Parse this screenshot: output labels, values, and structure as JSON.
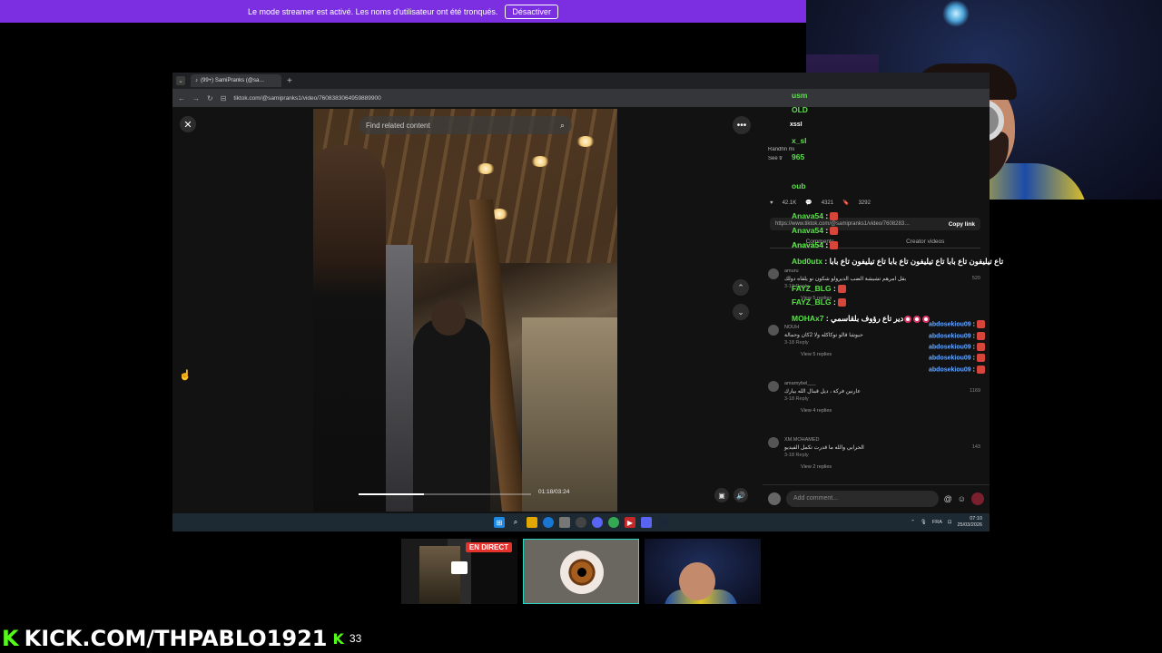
{
  "banner": {
    "text": "Le mode streamer est activé. Les noms d'utilisateur ont été tronqués.",
    "button": "Désactiver"
  },
  "browser": {
    "tab_title": "(99+) SamiPranks (@sa…",
    "url": "tiktok.com/@samipranks1/video/7608383064959889900"
  },
  "viewer": {
    "search_placeholder": "Find related content",
    "time": "01:18/03:24",
    "progress": 0.38
  },
  "panel": {
    "line1": "xssl",
    "line2": "Randhn mi",
    "line3": "See tr",
    "stats": [
      "42.1K",
      "4321",
      "3292"
    ],
    "link_url": "https://www.tiktok.com/@samipranks1/video/7608283…",
    "copy_link": "Copy link",
    "tabs": [
      "Comments",
      "Creator videos"
    ],
    "comments": [
      {
        "user": "amuru",
        "text": "بقل امرهم تشيشة الضب الديرولو شكون نو يلقاه دولك",
        "date": "3-19",
        "reply": "Reply",
        "likes": "520",
        "replies": "View 5 replies"
      },
      {
        "user": "NOUH",
        "text": "حبوشا قالو توكاكله ولا 2كان وحمالة",
        "date": "3-18",
        "reply": "Reply",
        "likes": "",
        "replies": "View 5 replies"
      },
      {
        "user": "amamybel___",
        "text": "عارنين فركة ، ديل قبنال الله بيارك",
        "date": "3-18",
        "reply": "Reply",
        "likes": "1169",
        "replies": "View 4 replies"
      },
      {
        "user": "XM.MOHAMED",
        "text": "الحرابي والله ما قدرت تكمل الفيديو",
        "date": "3-18",
        "reply": "Reply",
        "likes": "143",
        "replies": "View 2 replies"
      }
    ],
    "comment_placeholder": "Add comment..."
  },
  "taskbar": {
    "lang": "FRA",
    "time": "07:10",
    "date": "25/03/2026"
  },
  "chat": [
    {
      "user": "usm",
      "text": ""
    },
    {
      "user": "OLD",
      "text": ""
    },
    {
      "user": "x_sl",
      "text": ""
    },
    {
      "user": "965",
      "text": ""
    },
    {
      "user": "oub",
      "text": ""
    },
    {
      "user": "Anava54",
      "text": ":"
    },
    {
      "user": "Anava54",
      "text": ":"
    },
    {
      "user": "Anava54",
      "text": ":"
    },
    {
      "user": "Anava54",
      "text": ":"
    },
    {
      "user": "Abd0utx",
      "text": ": تاع تيليفون تاع بابا تاع تيليفون تاع بابا تاع تيليفون تاع بابا"
    },
    {
      "user": "FAYZ_BLG",
      "text": ":"
    },
    {
      "user": "FAYZ_BLG",
      "text": ":"
    },
    {
      "user": "MOHAx7",
      "text": ": دير تاع رؤوف بلقاسمي"
    },
    {
      "user": "abdosekiou09",
      "text": ":"
    },
    {
      "user": "abdosekiou09",
      "text": ":"
    },
    {
      "user": "abdosekiou09",
      "text": ":"
    },
    {
      "user": "abdosekiou09",
      "text": ":"
    },
    {
      "user": "abdosekiou09",
      "text": ":"
    }
  ],
  "thumbnails": {
    "live_badge": "EN DIRECT"
  },
  "kick": {
    "url": "KICK.COM/THPABLO1921",
    "count": "33"
  },
  "colors": {
    "banner": "#7b2fe0",
    "kick_green": "#53fc18",
    "live_red": "#e5322d"
  }
}
